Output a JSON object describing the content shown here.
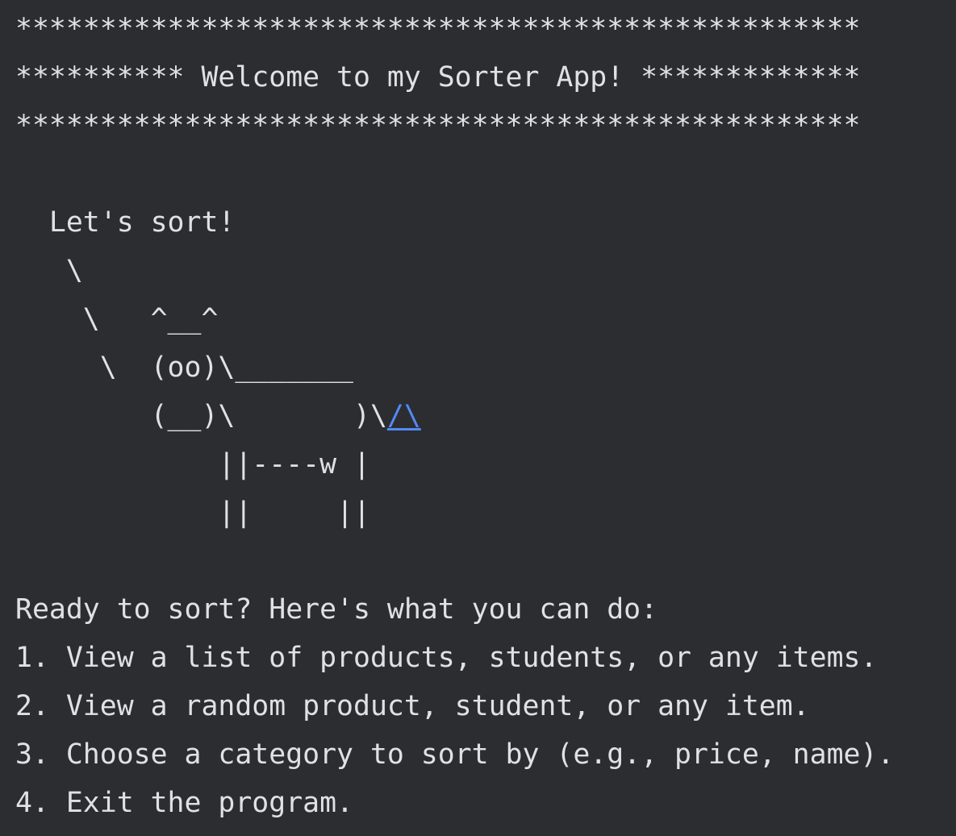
{
  "console": {
    "banner": [
      "**************************************************",
      "********** Welcome to my Sorter App! *************",
      "**************************************************"
    ],
    "art": {
      "speech": "  Let's sort!",
      "line1": "   \\",
      "line2": "    \\   ^__^",
      "line3": "     \\  (oo)\\_______",
      "line4_prefix": "        (__)\\       )\\",
      "line4_link": "/\\",
      "line5": "            ||----w |",
      "line6": "            ||     ||"
    },
    "menu": {
      "intro": "Ready to sort? Here's what you can do:",
      "items": [
        "1. View a list of products, students, or any items.",
        "2. View a random product, student, or any item.",
        "3. Choose a category to sort by (e.g., price, name).",
        "4. Exit the program."
      ]
    },
    "colors": {
      "background": "#2b2d30",
      "text": "#dfe1e5",
      "link": "#548af7"
    }
  }
}
